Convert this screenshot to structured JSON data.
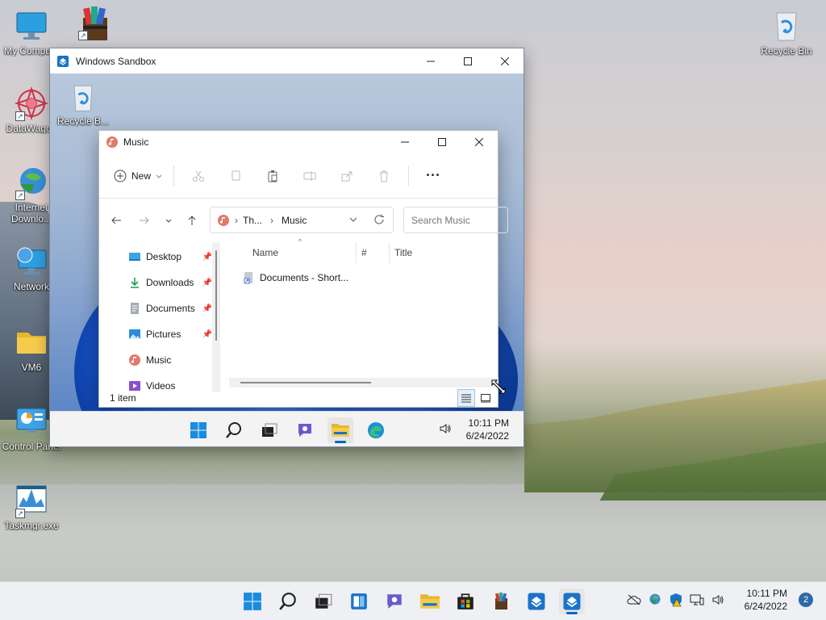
{
  "desktop": {
    "icons": [
      {
        "label": "My Compu...",
        "icon": "computer-icon"
      },
      {
        "label": "",
        "icon": "winrar-icon"
      },
      {
        "label": "DataWagon",
        "icon": "datawagon-icon"
      },
      {
        "label": "Internet Downlo...",
        "icon": "internet-download-manager-icon"
      },
      {
        "label": "Network",
        "icon": "network-icon"
      },
      {
        "label": "VM6",
        "icon": "folder-icon"
      },
      {
        "label": "Control Panel",
        "icon": "control-panel-icon"
      },
      {
        "label": "Taskmgr.exe",
        "icon": "task-manager-icon"
      },
      {
        "label": "Recycle Bin",
        "icon": "recycle-bin-icon"
      }
    ]
  },
  "sandbox": {
    "title": "Windows Sandbox",
    "desktop_icon_label": "Recycle B...",
    "clock_time": "10:11 PM",
    "clock_date": "6/24/2022"
  },
  "explorer": {
    "title": "Music",
    "toolbar": {
      "new_label": "New"
    },
    "address": {
      "crumb1": "Th...",
      "crumb2": "Music"
    },
    "search_placeholder": "Search Music",
    "sidebar": [
      {
        "label": "Desktop",
        "pinned": true
      },
      {
        "label": "Downloads",
        "pinned": true
      },
      {
        "label": "Documents",
        "pinned": true
      },
      {
        "label": "Pictures",
        "pinned": true
      },
      {
        "label": "Music",
        "pinned": false
      },
      {
        "label": "Videos",
        "pinned": false
      }
    ],
    "columns": {
      "name": "Name",
      "number": "#",
      "title": "Title"
    },
    "files": [
      {
        "name": "Documents - Short..."
      }
    ],
    "status": "1 item"
  },
  "taskbar": {
    "clock_time": "10:11 PM",
    "clock_date": "6/24/2022",
    "notification_count": "2"
  },
  "colors": {
    "accent": "#0067c0",
    "notification_badge": "#2d6aa8"
  }
}
